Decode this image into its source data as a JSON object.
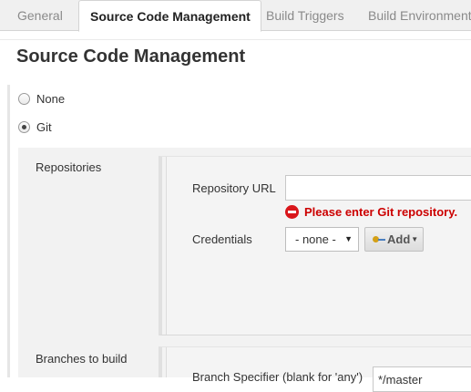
{
  "tabs": [
    {
      "label": "General",
      "active": false
    },
    {
      "label": "Source Code Management",
      "active": true
    },
    {
      "label": "Build Triggers",
      "active": false
    },
    {
      "label": "Build Environment",
      "active": false
    }
  ],
  "section": {
    "title": "Source Code Management"
  },
  "scm_options": [
    {
      "label": "None",
      "selected": false
    },
    {
      "label": "Git",
      "selected": true
    }
  ],
  "git": {
    "repositories_label": "Repositories",
    "repository_url_label": "Repository URL",
    "repository_url_value": "",
    "error_message": "Please enter Git repository.",
    "credentials_label": "Credentials",
    "credentials_selected": "- none -",
    "add_button_label": "Add",
    "branches_label": "Branches to build",
    "branch_specifier_label": "Branch Specifier (blank for 'any')",
    "branch_specifier_value": "*/master"
  },
  "colors": {
    "error": "#cc0000",
    "error_icon": "#d9161b"
  },
  "icons": {
    "error": "error-circle-icon",
    "credentials": "key-icon",
    "dropdown": "caret-down-icon"
  }
}
